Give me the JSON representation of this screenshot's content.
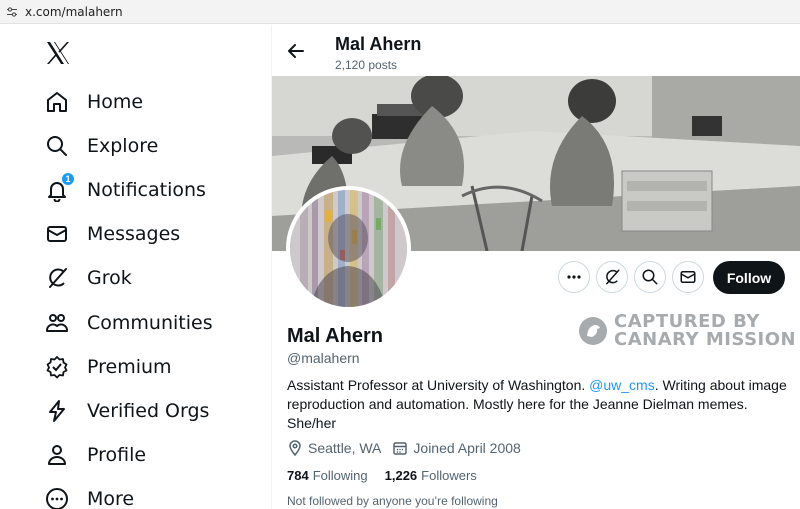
{
  "browser": {
    "url": "x.com/malahern"
  },
  "nav": {
    "items": [
      {
        "label": "Home",
        "icon": "home-icon"
      },
      {
        "label": "Explore",
        "icon": "search-icon"
      },
      {
        "label": "Notifications",
        "icon": "bell-icon",
        "badge": "1"
      },
      {
        "label": "Messages",
        "icon": "envelope-icon"
      },
      {
        "label": "Grok",
        "icon": "grok-icon"
      },
      {
        "label": "Communities",
        "icon": "people-icon"
      },
      {
        "label": "Premium",
        "icon": "verified-badge-icon"
      },
      {
        "label": "Verified Orgs",
        "icon": "lightning-icon"
      },
      {
        "label": "Profile",
        "icon": "person-icon"
      },
      {
        "label": "More",
        "icon": "more-circle-icon"
      }
    ]
  },
  "header": {
    "name": "Mal Ahern",
    "posts": "2,120 posts"
  },
  "profile": {
    "name": "Mal Ahern",
    "handle": "@malahern",
    "bio_before": "Assistant Professor at University of Washington. ",
    "bio_mention": "@uw_cms",
    "bio_after": ". Writing about image reproduction and automation. Mostly here for the Jeanne Dielman memes. She/her",
    "location": "Seattle, WA",
    "joined": "Joined April 2008",
    "following_count": "784",
    "following_label": "Following",
    "followers_count": "1,226",
    "followers_label": "Followers",
    "not_followed": "Not followed by anyone you’re following"
  },
  "actions": {
    "follow_label": "Follow"
  },
  "watermark": {
    "line1": "CAPTURED BY",
    "line2": "CANARY MISSION"
  },
  "colors": {
    "accent": "#1d9bf0",
    "text": "#0f1419",
    "muted": "#536471"
  }
}
